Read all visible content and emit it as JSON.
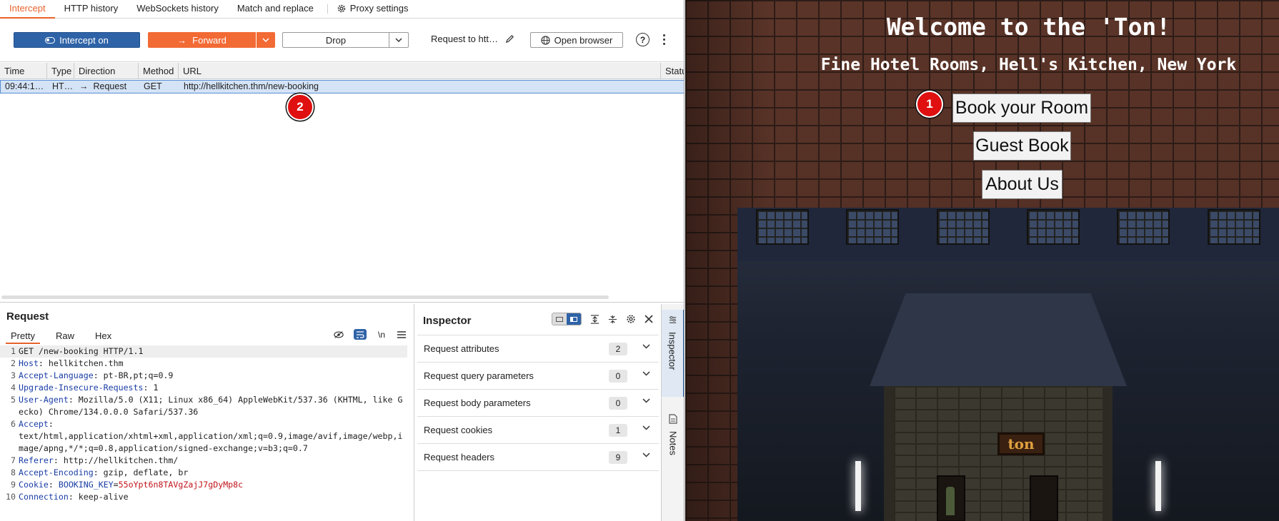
{
  "proxy": {
    "tabs": [
      "Intercept",
      "HTTP history",
      "WebSockets history",
      "Match and replace"
    ],
    "settings_tab": "Proxy settings",
    "toolbar": {
      "intercept_label": "Intercept on",
      "forward_label": "Forward",
      "drop_label": "Drop",
      "request_to": "Request to htt…",
      "open_browser": "Open browser",
      "help": "?"
    },
    "table": {
      "columns": [
        "Time",
        "Type",
        "Direction",
        "Method",
        "URL",
        "Status"
      ],
      "row": {
        "time": "09:44:1…",
        "type": "HT…",
        "direction": "Request",
        "method": "GET",
        "url": "http://hellkitchen.thm/new-booking"
      }
    }
  },
  "request": {
    "title": "Request",
    "tabs": [
      "Pretty",
      "Raw",
      "Hex"
    ],
    "newline_tool": "\\n",
    "lines": [
      {
        "n": "1",
        "k": "",
        "v": "GET /new-booking HTTP/1.1"
      },
      {
        "n": "2",
        "k": "Host",
        "v": " hellkitchen.thm"
      },
      {
        "n": "3",
        "k": "Accept-Language",
        "v": " pt-BR,pt;q=0.9"
      },
      {
        "n": "4",
        "k": "Upgrade-Insecure-Requests",
        "v": " 1"
      },
      {
        "n": "5",
        "k": "User-Agent",
        "v": " Mozilla/5.0 (X11; Linux x86_64) AppleWebKit/537.36 (KHTML, like Gecko) Chrome/134.0.0.0 Safari/537.36"
      },
      {
        "n": "6",
        "k": "Accept",
        "v": "\ntext/html,application/xhtml+xml,application/xml;q=0.9,image/avif,image/webp,image/apng,*/*;q=0.8,application/signed-exchange;v=b3;q=0.7"
      },
      {
        "n": "7",
        "k": "Referer",
        "v": " http://hellkitchen.thm/"
      },
      {
        "n": "8",
        "k": "Accept-Encoding",
        "v": " gzip, deflate, br"
      },
      {
        "n": "9",
        "k": "Cookie",
        "v": " ",
        "ck": "BOOKING_KEY",
        "cv": "55oYpt6n8TAVgZajJ7gDyMp8c"
      },
      {
        "n": "10",
        "k": "Connection",
        "v": " keep-alive"
      }
    ]
  },
  "inspector": {
    "title": "Inspector",
    "rows": [
      {
        "label": "Request attributes",
        "count": "2"
      },
      {
        "label": "Request query parameters",
        "count": "0"
      },
      {
        "label": "Request body parameters",
        "count": "0"
      },
      {
        "label": "Request cookies",
        "count": "1"
      },
      {
        "label": "Request headers",
        "count": "9"
      }
    ],
    "rail": [
      "Inspector",
      "Notes"
    ]
  },
  "site": {
    "title": "Welcome to the 'Ton!",
    "subtitle": "Fine Hotel Rooms, Hell's Kitchen, New York",
    "buttons": [
      "Book your Room",
      "Guest Book",
      "About Us"
    ],
    "sign": "ton"
  },
  "annotations": [
    "1",
    "2"
  ],
  "colors": {
    "burp_accent": "#e8622c",
    "intercept_blue": "#2f63a7",
    "forward_orange": "#f26a34",
    "badge_red": "#e01010"
  }
}
